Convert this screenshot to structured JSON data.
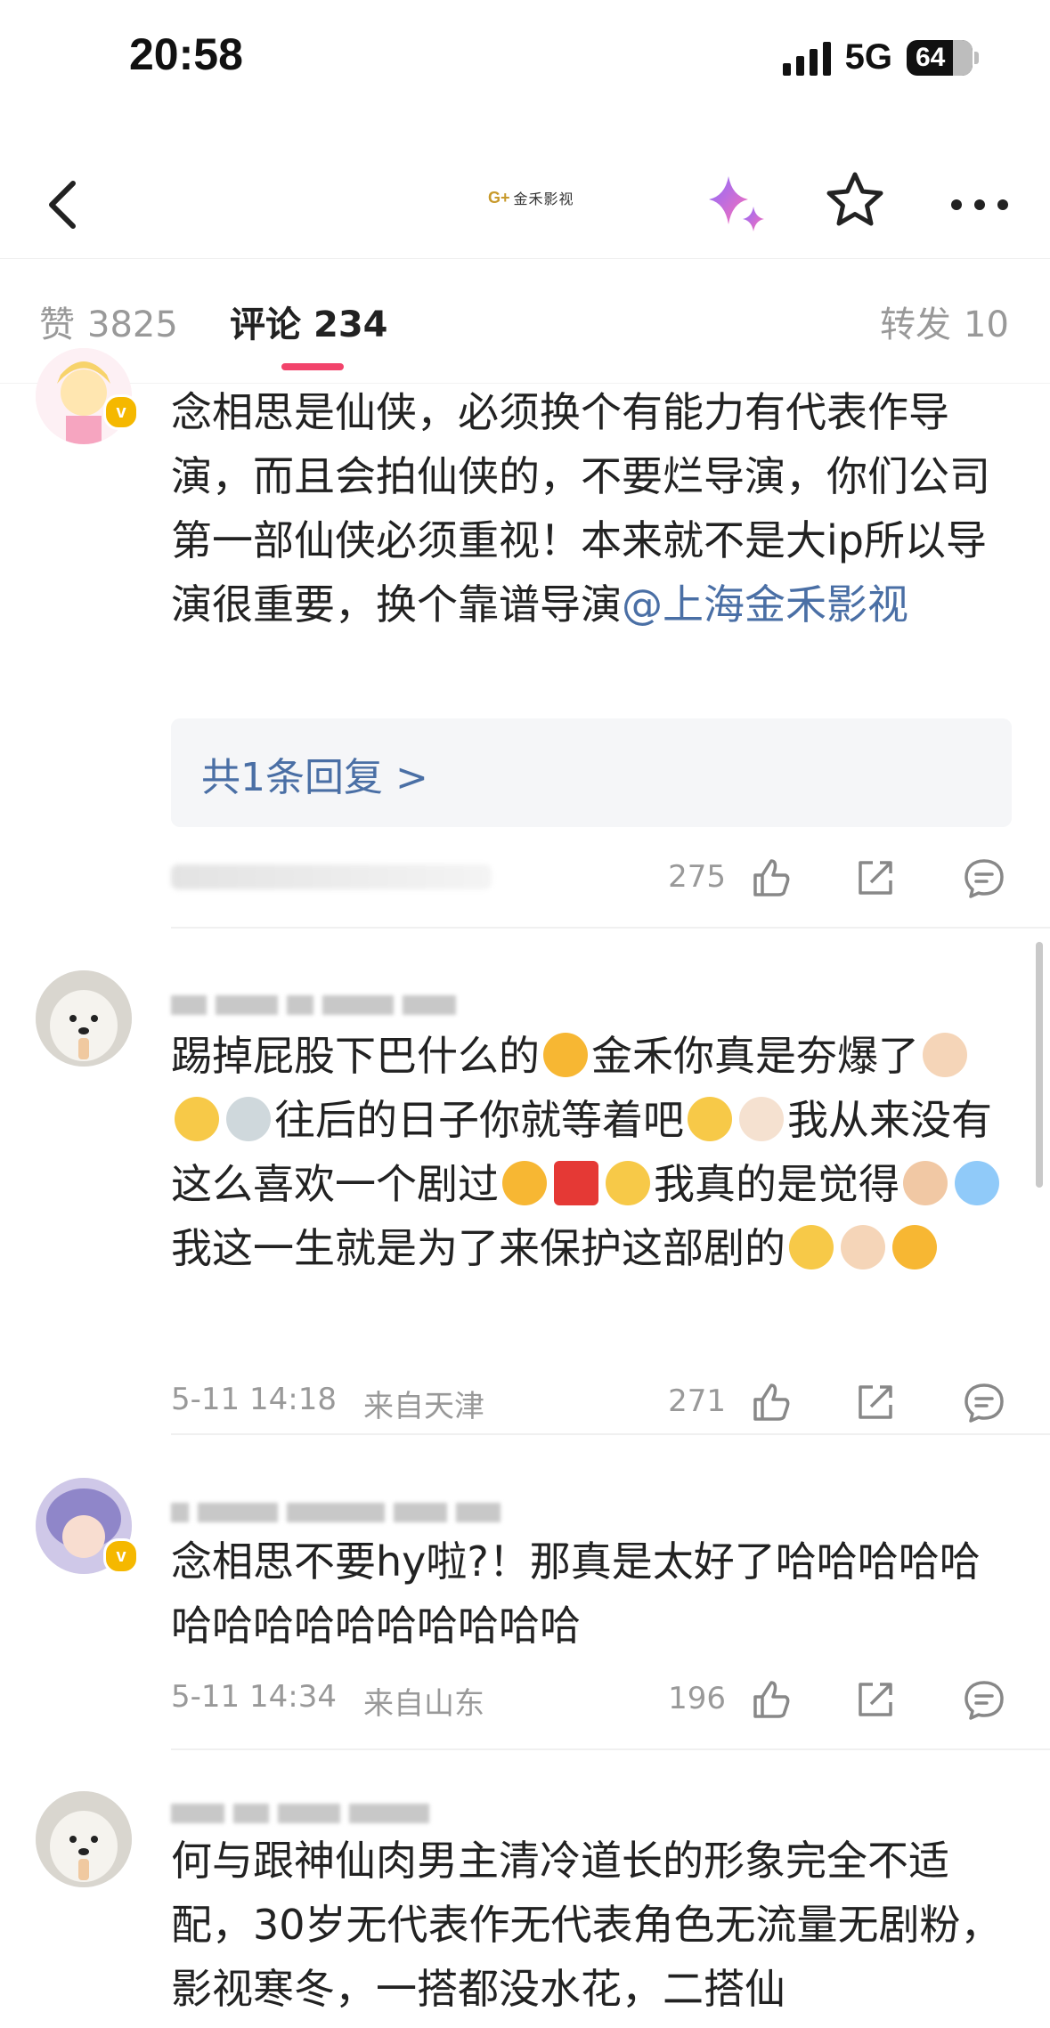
{
  "status_bar": {
    "time": "20:58",
    "network": "5G",
    "battery": "64"
  },
  "nav": {
    "brand_mark": "G+",
    "brand_name": "金禾影视"
  },
  "tabs": [
    {
      "label": "赞",
      "count": "3825"
    },
    {
      "label": "评论",
      "count": "234"
    },
    {
      "label": "转发",
      "count": "10"
    }
  ],
  "comments": [
    {
      "text": "念相思是仙侠，必须换个有能力有代表作导演，而且会拍仙侠的，不要烂导演，你们公司第一部仙侠必须重视！本来就不是大ip所以导演很重要，换个靠谱导演",
      "mention": "@上海金禾影视",
      "reply_label": "共1条回复 >",
      "likes": "275"
    },
    {
      "text_parts": [
        "踢掉屁股下巴什么的",
        "金禾你真是夯爆了",
        "往后的日子你就等着吧",
        "我从来没有这么喜欢一个剧过",
        "我真的是觉得",
        "我这一生就是为了来保护这部剧的"
      ],
      "date": "5-11 14:18",
      "location": "来自天津",
      "likes": "271"
    },
    {
      "text": "念相思不要hy啦?！那真是太好了哈哈哈哈哈哈哈哈哈哈哈哈哈哈哈",
      "date": "5-11 14:34",
      "location": "来自山东",
      "likes": "196"
    },
    {
      "text": "何与跟神仙肉男主清冷道长的形象完全不适配，30岁无代表作无代表角色无流量无剧粉，影视寒冬，一搭都没水花，二搭仙"
    }
  ],
  "colors": {
    "accent": "#f2436b",
    "link": "#4a6fa5",
    "muted": "#999999"
  },
  "icons": [
    "back-icon",
    "sparkle-icon",
    "star-icon",
    "more-icon",
    "like-icon",
    "share-icon",
    "comment-icon"
  ]
}
